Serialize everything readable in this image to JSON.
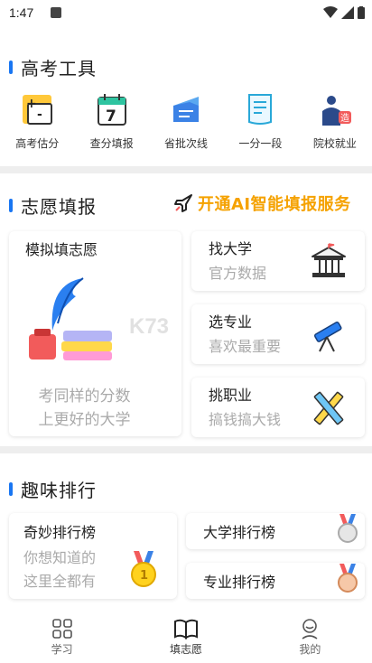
{
  "status": {
    "time": "1:47"
  },
  "tools_section": {
    "title": "高考工具",
    "items": [
      {
        "label": "高考估分",
        "icon": "score-estimate-icon"
      },
      {
        "label": "查分填报",
        "icon": "calendar-icon",
        "icon_text": "7"
      },
      {
        "label": "省批次线",
        "icon": "batch-line-icon"
      },
      {
        "label": "一分一段",
        "icon": "document-icon"
      },
      {
        "label": "院校就业",
        "icon": "employment-icon",
        "badge": "造"
      }
    ]
  },
  "volunteer_section": {
    "title": "志愿填报",
    "promo": "开通AI智能填报服务",
    "big_card": {
      "title": "模拟填志愿",
      "sub1": "考同样的分数",
      "sub2": "上更好的大学"
    },
    "cards": [
      {
        "title": "找大学",
        "sub": "官方数据",
        "icon": "university-icon"
      },
      {
        "title": "选专业",
        "sub": "喜欢最重要",
        "icon": "telescope-icon"
      },
      {
        "title": "挑职业",
        "sub": "搞钱搞大钱",
        "icon": "tools-icon"
      }
    ]
  },
  "ranking_section": {
    "title": "趣味排行",
    "big_card": {
      "title": "奇妙排行榜",
      "sub1": "你想知道的",
      "sub2": "这里全都有"
    },
    "cards": [
      {
        "title": "大学排行榜",
        "icon": "silver-medal-icon"
      },
      {
        "title": "专业排行榜",
        "icon": "bronze-medal-icon"
      }
    ]
  },
  "tabbar": {
    "tabs": [
      {
        "label": "学习",
        "icon": "grid-icon"
      },
      {
        "label": "填志愿",
        "icon": "book-icon",
        "active": true
      },
      {
        "label": "我的",
        "icon": "user-icon"
      }
    ]
  },
  "watermark": "K73",
  "colors": {
    "accent": "#1976f2",
    "promo": "#f5a200"
  }
}
